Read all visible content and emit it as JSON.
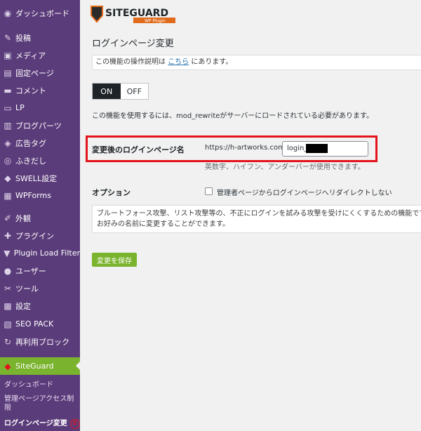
{
  "sidebar": {
    "items": [
      {
        "icon": "dashboard-icon",
        "glyph": "◉",
        "label": "ダッシュボード"
      },
      {
        "icon": "pin-icon",
        "glyph": "✎",
        "label": "投稿"
      },
      {
        "icon": "media-icon",
        "glyph": "▣",
        "label": "メディア"
      },
      {
        "icon": "pages-icon",
        "glyph": "▤",
        "label": "固定ページ"
      },
      {
        "icon": "comment-icon",
        "glyph": "▬",
        "label": "コメント"
      },
      {
        "icon": "lp-icon",
        "glyph": "▭",
        "label": "LP"
      },
      {
        "icon": "blog-parts-icon",
        "glyph": "▥",
        "label": "ブログパーツ"
      },
      {
        "icon": "tag-icon",
        "glyph": "◈",
        "label": "広告タグ"
      },
      {
        "icon": "balloon-icon",
        "glyph": "◎",
        "label": "ふきだし"
      },
      {
        "icon": "swell-icon",
        "glyph": "◆",
        "label": "SWELL設定"
      },
      {
        "icon": "forms-icon",
        "glyph": "▦",
        "label": "WPForms"
      },
      {
        "icon": "appearance-icon",
        "glyph": "✐",
        "label": "外観"
      },
      {
        "icon": "plugin-icon",
        "glyph": "✚",
        "label": "プラグイン"
      },
      {
        "icon": "filter-icon",
        "glyph": "▼",
        "label": "Plugin Load Filter"
      },
      {
        "icon": "user-icon",
        "glyph": "●",
        "label": "ユーザー"
      },
      {
        "icon": "tools-icon",
        "glyph": "✂",
        "label": "ツール"
      },
      {
        "icon": "settings-icon",
        "glyph": "▩",
        "label": "設定"
      },
      {
        "icon": "seo-icon",
        "glyph": "▧",
        "label": "SEO PACK"
      },
      {
        "icon": "reuse-block-icon",
        "glyph": "↻",
        "label": "再利用ブロック"
      }
    ],
    "active": {
      "icon": "siteguard-icon",
      "glyph": "◆",
      "label": "SiteGuard"
    },
    "sub_items": [
      "ダッシュボード",
      "管理ページアクセス制限",
      "ログインページ変更"
    ],
    "marker": "①"
  },
  "main": {
    "logo_text": "SITEGUARD",
    "logo_sub": "WP Plugin",
    "page_title": "ログインページ変更",
    "notice_before": "この機能の操作説明は",
    "notice_link": "こちら",
    "notice_after": "にあります。",
    "toggle_on": "ON",
    "toggle_off": "OFF",
    "requirement": "この機能を使用するには、mod_rewriteがサーバーにロードされている必要があります。",
    "field_label": "変更後のログインページ名",
    "url_prefix": "https://h-artworks.com/",
    "login_value": "login_",
    "hint": "英数字、ハイフン、アンダーバーが使用できます。",
    "option_label": "オプション",
    "option_checkbox_label": "管理者ページからログインページへリダイレクトしない",
    "description_line1": "ブルートフォース攻撃、リスト攻撃等の、不正にログインを試みる攻撃を受けにくくするための機能です。ロ",
    "description_line2": "お好みの名前に変更することができます。",
    "save_label": "変更を保存"
  },
  "colors": {
    "sidebar_bg": "#5b3c7a",
    "active_green": "#7ab32e",
    "highlight_red": "#e3141b",
    "link_blue": "#2271b1"
  }
}
